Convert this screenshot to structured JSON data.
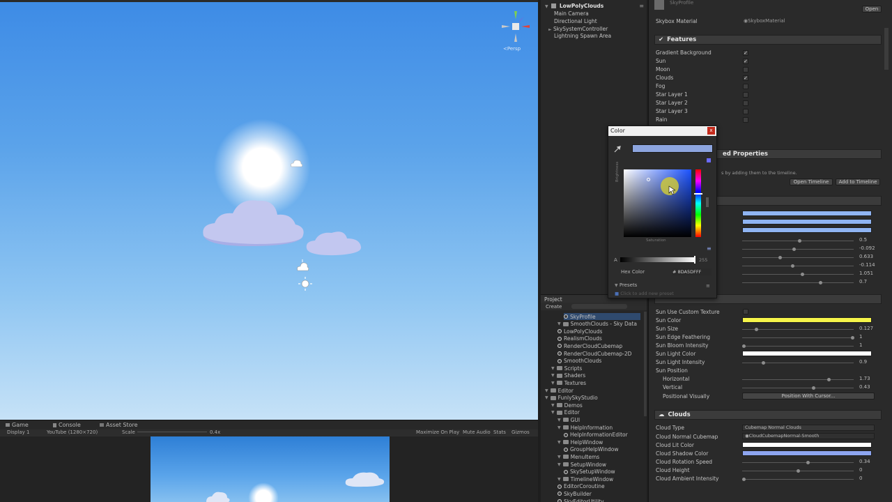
{
  "hierarchy": {
    "root": "LowPolyClouds",
    "items": [
      "Main Camera",
      "Directional Light",
      "SkySystemController",
      "Lightning Spawn Area"
    ]
  },
  "scene": {
    "persp_label": "<Persp"
  },
  "game": {
    "tabs": [
      "Game",
      "Console",
      "Asset Store"
    ],
    "display": "Display 1",
    "resolution": "YouTube (1280×720)",
    "scale_label": "Scale",
    "scale_value": "0.4x",
    "toolbar": [
      "Maximize On Play",
      "Mute Audio",
      "Stats",
      "Gizmos"
    ]
  },
  "project": {
    "tab": "Project",
    "create": "Create",
    "rows": [
      {
        "label": "SkyProfile",
        "kind": "asset",
        "indent": 3
      },
      {
        "label": "SmoothClouds - Sky Data",
        "kind": "folder",
        "indent": 2
      },
      {
        "label": "LowPolyClouds",
        "kind": "asset",
        "indent": 2
      },
      {
        "label": "RealismClouds",
        "kind": "asset",
        "indent": 2
      },
      {
        "label": "RenderCloudCubemap",
        "kind": "asset",
        "indent": 2
      },
      {
        "label": "RenderCloudCubemap-2D",
        "kind": "asset",
        "indent": 2
      },
      {
        "label": "SmoothClouds",
        "kind": "asset",
        "indent": 2
      },
      {
        "label": "Scripts",
        "kind": "folder",
        "indent": 1
      },
      {
        "label": "Shaders",
        "kind": "folder",
        "indent": 1
      },
      {
        "label": "Textures",
        "kind": "folder",
        "indent": 1
      },
      {
        "label": "Editor",
        "kind": "folder",
        "indent": 0
      },
      {
        "label": "FunlySkyStudio",
        "kind": "folder",
        "indent": 0
      },
      {
        "label": "Demos",
        "kind": "folder",
        "indent": 1
      },
      {
        "label": "Editor",
        "kind": "folder",
        "indent": 1
      },
      {
        "label": "GUI",
        "kind": "folder",
        "indent": 2
      },
      {
        "label": "HelpInformation",
        "kind": "folder",
        "indent": 2
      },
      {
        "label": "HelpInformationEditor",
        "kind": "asset",
        "indent": 3
      },
      {
        "label": "HelpWindow",
        "kind": "folder",
        "indent": 2
      },
      {
        "label": "GroupHelpWindow",
        "kind": "asset",
        "indent": 3
      },
      {
        "label": "MenuItems",
        "kind": "folder",
        "indent": 2
      },
      {
        "label": "SetupWindow",
        "kind": "folder",
        "indent": 2
      },
      {
        "label": "SkySetupWindow",
        "kind": "asset",
        "indent": 3
      },
      {
        "label": "TimelineWindow",
        "kind": "folder",
        "indent": 2
      },
      {
        "label": "EditorCoroutine",
        "kind": "asset",
        "indent": 2
      },
      {
        "label": "SkyBuilder",
        "kind": "asset",
        "indent": 2
      },
      {
        "label": "SkyEditorUtility",
        "kind": "asset",
        "indent": 2
      }
    ]
  },
  "inspector": {
    "profile_name": "SkyProfile",
    "open_button": "Open",
    "skybox_label": "Skybox Material",
    "skybox_value": "SkyboxMaterial",
    "features_title": "Features",
    "features": [
      {
        "label": "Gradient Background",
        "checked": true
      },
      {
        "label": "Sun",
        "checked": true
      },
      {
        "label": "Moon",
        "checked": false
      },
      {
        "label": "Clouds",
        "checked": true
      },
      {
        "label": "Fog",
        "checked": false
      },
      {
        "label": "Star Layer 1",
        "checked": false
      },
      {
        "label": "Star Layer 2",
        "checked": false
      },
      {
        "label": "Star Layer 3",
        "checked": false
      },
      {
        "label": "Rain",
        "checked": false
      }
    ],
    "animated_title": "ed Properties",
    "animated_hint": "s by adding them to the timeline.",
    "open_timeline": "Open Timeline",
    "add_timeline": "Add to Timeline",
    "sky_values": [
      "0.5",
      "-0.092",
      "0.633",
      "-0.114",
      "1.051",
      "0.7"
    ],
    "sun_rows": {
      "custom_texture": "Sun Use Custom Texture",
      "color": "Sun Color",
      "size": "Sun Size",
      "size_val": "0.127",
      "edge": "Sun Edge Feathering",
      "edge_val": "1",
      "bloom": "Sun Bloom Intensity",
      "bloom_val": "1",
      "light_color": "Sun Light Color",
      "light_intensity": "Sun Light Intensity",
      "light_intensity_val": "0.9",
      "position": "Sun Position",
      "horizontal": "Horizontal",
      "horizontal_val": "1.73",
      "vertical": "Vertical",
      "vertical_val": "0.43",
      "pos_visually": "Positional Visually",
      "pos_button": "Position With Cursor..."
    },
    "clouds_title": "Clouds",
    "cloud_rows": {
      "type": "Cloud Type",
      "type_val": "Cubemap Normal Clouds",
      "cubemap": "Cloud Normal Cubemap",
      "cubemap_val": "CloudCubemapNormal-Smooth",
      "lit": "Cloud Lit Color",
      "shadow": "Cloud Shadow Color",
      "rotation": "Cloud Rotation Speed",
      "rotation_val": "0.34",
      "height": "Cloud Height",
      "height_val": "0",
      "ambient": "Cloud Ambient Intensity",
      "ambient_val": "0"
    },
    "colors": {
      "sky_bars": "#8fb4f2",
      "sun_color": "#f6f54a",
      "sun_light": "#ffffff",
      "cloud_lit": "#ffffff",
      "cloud_shadow": "#8da5ef"
    }
  },
  "color_picker": {
    "title": "Color",
    "close": "x",
    "current_color": "#8DA5DF",
    "alpha_label": "A",
    "alpha_value": "255",
    "hex_label": "Hex Color",
    "hex_value": "# 8DA5DFFF",
    "presets_label": "Presets",
    "add_preset": "Click to add new preset",
    "brightness_label": "Brightness",
    "saturation_label": "Saturation"
  }
}
